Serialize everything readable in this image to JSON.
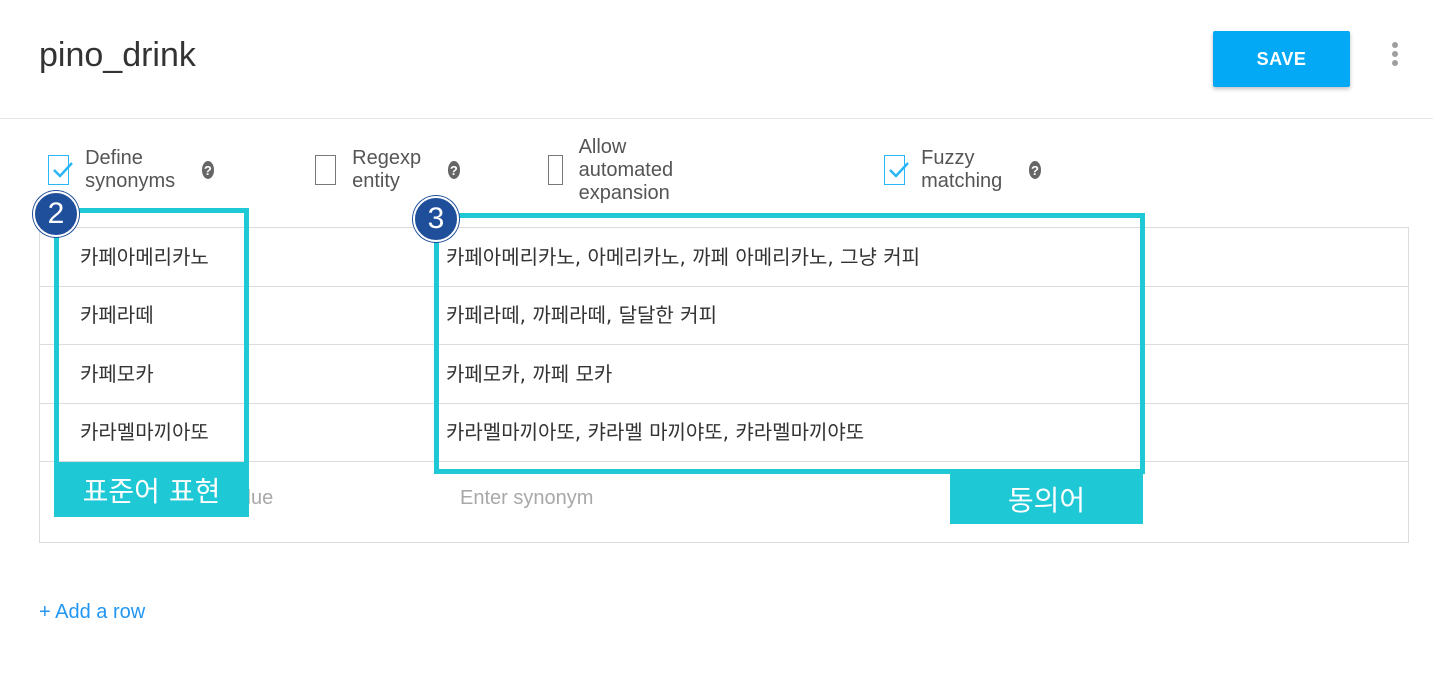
{
  "header": {
    "title": "pino_drink",
    "save_label": "SAVE"
  },
  "options": [
    {
      "label": "Define synonyms",
      "checked": true,
      "help": true
    },
    {
      "label": "Regexp entity",
      "checked": false,
      "help": true
    },
    {
      "label": "Allow automated expansion",
      "checked": false,
      "help": false
    },
    {
      "label": "Fuzzy matching",
      "checked": true,
      "help": true
    }
  ],
  "help_glyph": "?",
  "entries": [
    {
      "value": "카페아메리카노",
      "synonyms": "카페아메리카노, 아메리카노, 까페 아메리카노, 그냥 커피"
    },
    {
      "value": "카페라떼",
      "synonyms": "카페라떼, 까페라떼, 달달한 커피"
    },
    {
      "value": "카페모카",
      "synonyms": "카페모카, 까페 모카"
    },
    {
      "value": "카라멜마끼아또",
      "synonyms": "카라멜마끼아또, 캬라멜 마끼야또, 캬라멜마끼야또"
    }
  ],
  "new_row": {
    "value_placeholder": "Enter reference value",
    "synonym_placeholder": "Enter synonym"
  },
  "add_row_label": "+ Add a row",
  "annotations": {
    "badge_2": "2",
    "badge_3": "3",
    "tag_value": "표준어 표현",
    "tag_synonym": "동의어",
    "accent": "#1ec8d4",
    "badge_color": "#1f4e9a"
  },
  "colors": {
    "save_button": "#03a9f4",
    "checkbox": "#29b6f6",
    "link": "#2196f3"
  }
}
